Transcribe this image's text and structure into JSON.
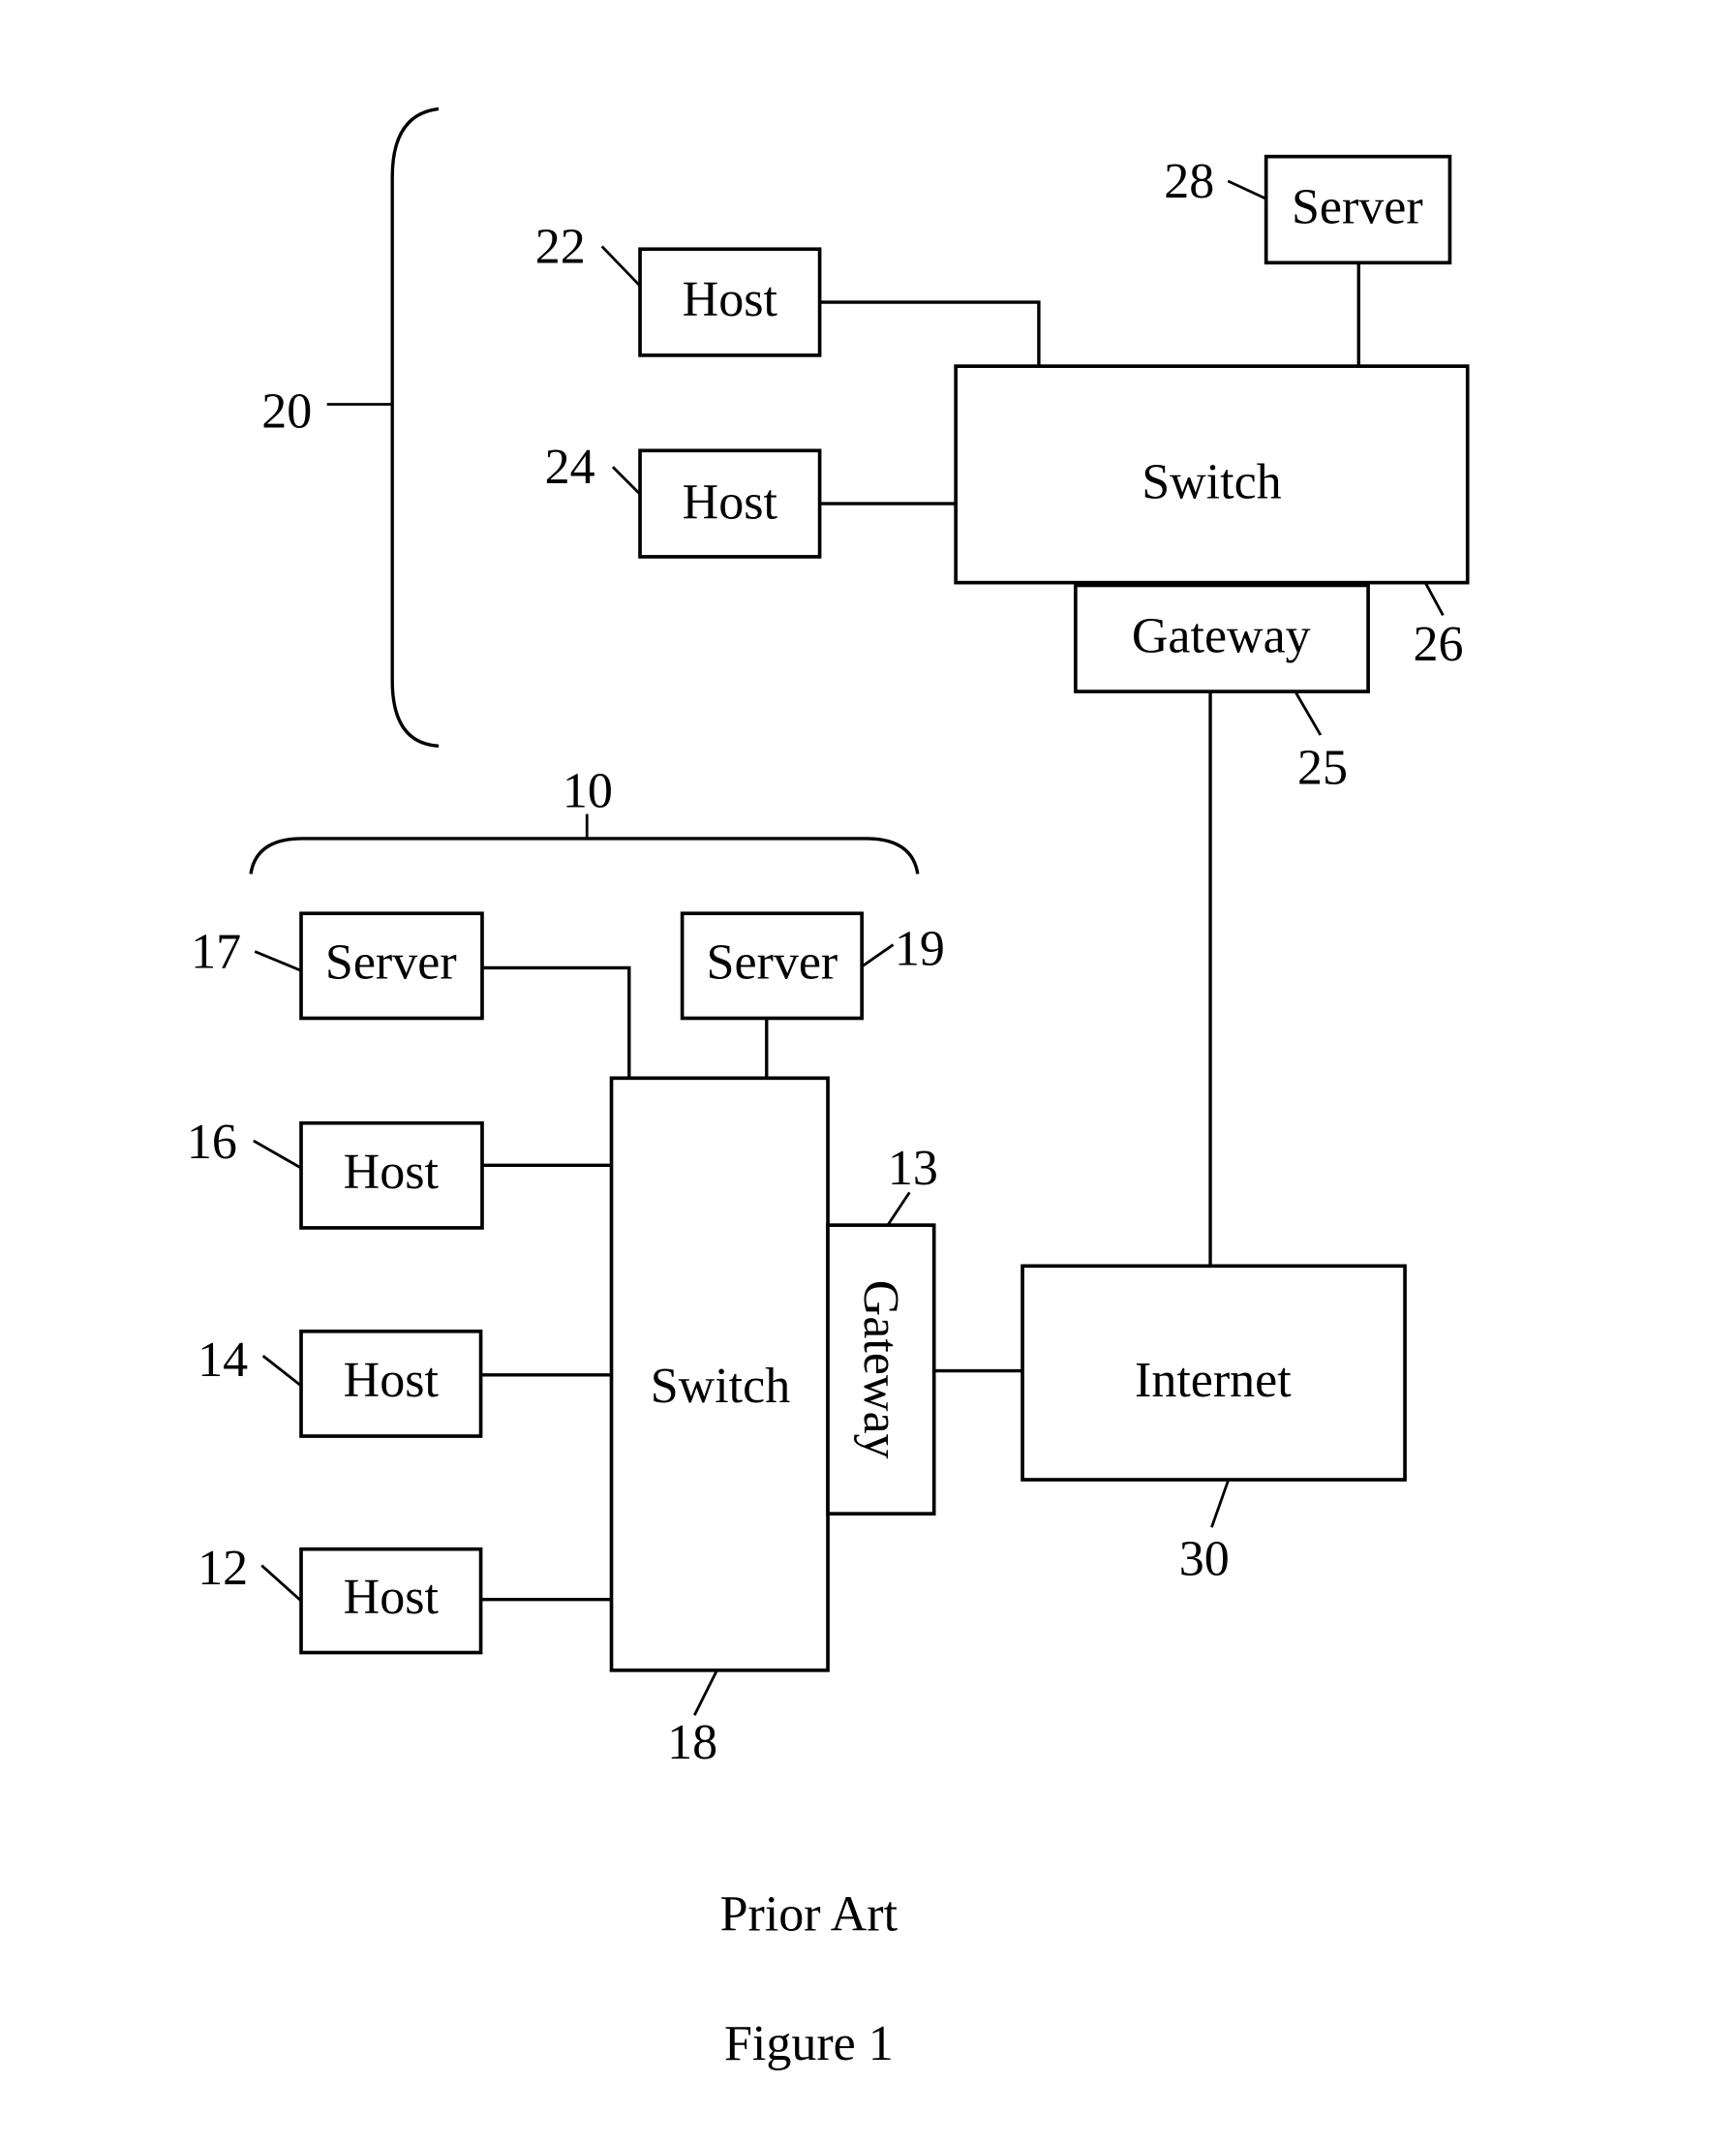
{
  "figure": {
    "caption_note": "Prior Art",
    "caption_title": "Figure 1"
  },
  "network_20": {
    "ref": "20",
    "host_22": {
      "ref": "22",
      "label": "Host"
    },
    "host_24": {
      "ref": "24",
      "label": "Host"
    },
    "server_28": {
      "ref": "28",
      "label": "Server"
    },
    "switch_26": {
      "ref": "26",
      "label": "Switch"
    },
    "gateway_25": {
      "ref": "25",
      "label": "Gateway"
    }
  },
  "network_10": {
    "ref": "10",
    "server_17": {
      "ref": "17",
      "label": "Server"
    },
    "server_19": {
      "ref": "19",
      "label": "Server"
    },
    "host_16": {
      "ref": "16",
      "label": "Host"
    },
    "host_14": {
      "ref": "14",
      "label": "Host"
    },
    "host_12": {
      "ref": "12",
      "label": "Host"
    },
    "switch_18": {
      "ref": "18",
      "label": "Switch"
    },
    "gateway_13": {
      "ref": "13",
      "label": "Gateway"
    }
  },
  "internet_30": {
    "ref": "30",
    "label": "Internet"
  }
}
